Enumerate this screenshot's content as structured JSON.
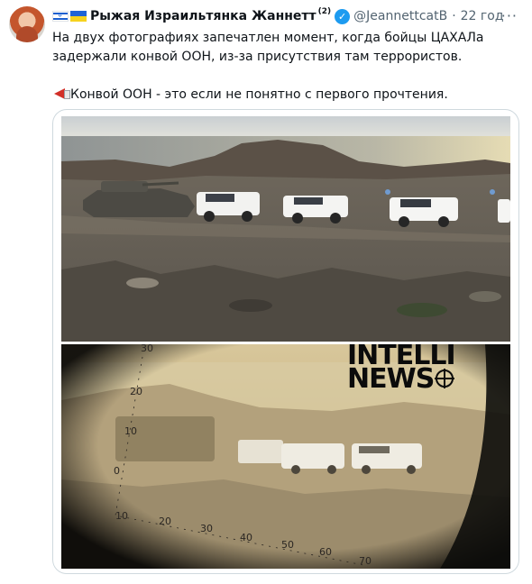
{
  "tweet": {
    "author": {
      "name": "Рыжая Израильтянка Жаннетт",
      "superscript": "(2)",
      "handle": "@JeannettcatB",
      "time": "22 год",
      "verified": true
    },
    "text": {
      "line1": "На двух фотографиях запечатлен момент, когда бойцы ЦАХАЛа",
      "line2": "задержали конвой ООН, из-за присутствия там террористов.",
      "line3": "Конвой ООН - это если не понятно с первого прочтения."
    },
    "media": {
      "watermark_line1": "INTELLI",
      "watermark_line2": "NEWS",
      "scale_labels": [
        "30",
        "20",
        "10",
        "0",
        "10",
        "20",
        "30",
        "40",
        "50",
        "60",
        "70"
      ]
    }
  },
  "icons": {
    "more": "more-icon",
    "verified": "verified-badge-icon",
    "megaphone": "megaphone-icon"
  },
  "colors": {
    "verified": "#1d9bf0",
    "secondary_text": "#536471",
    "border": "#cfd9de"
  }
}
